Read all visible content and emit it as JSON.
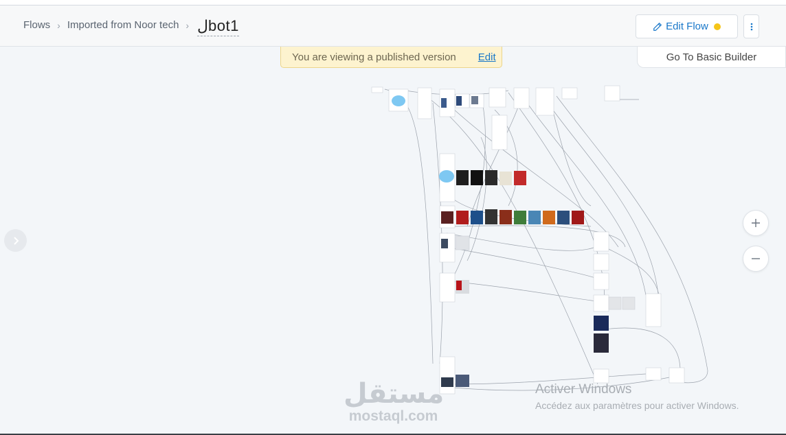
{
  "header": {
    "breadcrumb": [
      "Flows",
      "Imported from Noor tech"
    ],
    "flow_name": "لbot1",
    "edit_flow_label": "Edit Flow",
    "status_dot_color": "#f5c518",
    "more_icon": "kebab-vertical-icon"
  },
  "banner": {
    "message": "You are viewing a published version",
    "edit_label": "Edit"
  },
  "basic_builder_label": "Go To Basic Builder",
  "zoom": {
    "in_icon": "plus-icon",
    "out_icon": "minus-icon"
  },
  "side_toggle_icon": "chevron-right-icon",
  "watermark": {
    "title": "Activer Windows",
    "subtitle": "Accédez aux paramètres pour activer Windows.",
    "logo_arabic": "مستقل",
    "logo_latin": "mostaql.com"
  },
  "colors": {
    "accent": "#1877c9",
    "canvas": "#f3f6f9",
    "banner": "#fdf3cf"
  }
}
